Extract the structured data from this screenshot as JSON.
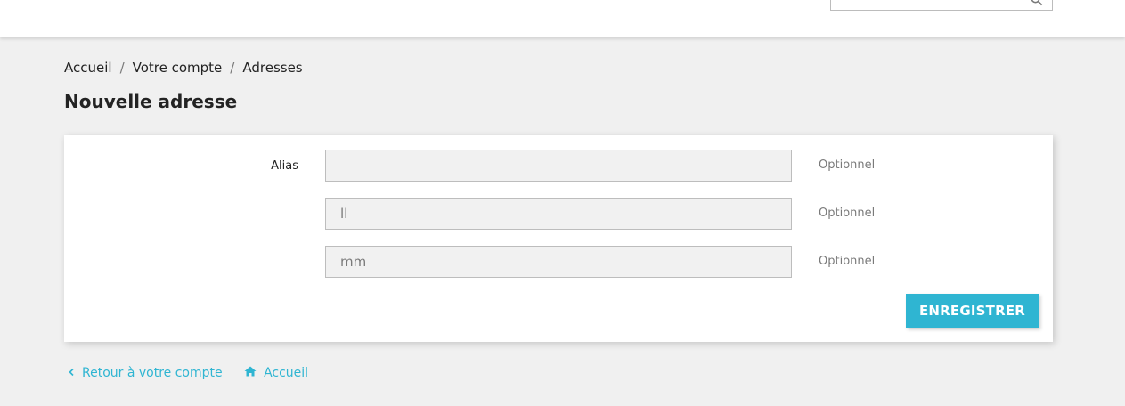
{
  "search": {
    "placeholder": "",
    "value": ""
  },
  "breadcrumb": {
    "items": [
      "Accueil",
      "Votre compte",
      "Adresses"
    ],
    "separator": "/"
  },
  "page": {
    "title": "Nouvelle adresse"
  },
  "form": {
    "fields": [
      {
        "label": "Alias",
        "value": "",
        "hint": "Optionnel"
      },
      {
        "label": "",
        "value": "ll",
        "hint": "Optionnel"
      },
      {
        "label": "",
        "value": "mm",
        "hint": "Optionnel"
      }
    ],
    "save_label": "ENREGISTRER"
  },
  "footer": {
    "back_label": "Retour à votre compte",
    "home_label": "Accueil"
  },
  "colors": {
    "accent": "#2fb5d2",
    "background": "#f0f0f0",
    "card": "#ffffff",
    "text": "#232323",
    "muted": "#7a7a7a"
  },
  "icons": {
    "search": "search-icon",
    "back": "chevron-left-icon",
    "home": "home-icon"
  }
}
